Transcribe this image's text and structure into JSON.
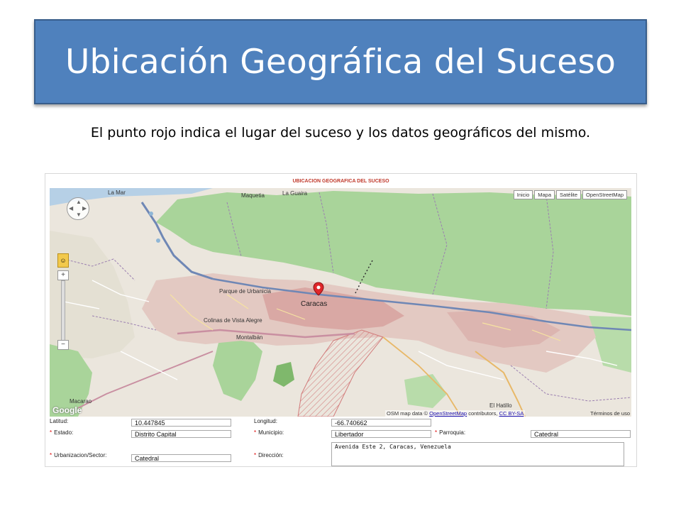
{
  "slide": {
    "title": "Ubicación Geográfica del Suceso",
    "subtitle": "El punto rojo indica el lugar del suceso y los datos geográficos del mismo."
  },
  "screenshot": {
    "header": "UBICACION GEOGRAFICA DEL SUCESO",
    "map_buttons": [
      "Inicio",
      "Mapa",
      "Satélite",
      "OpenStreetMap"
    ],
    "map_labels": {
      "la_mar": "La Mar",
      "maquetia": "Maquetia",
      "la_guaira": "La Guaira",
      "caracas": "Caracas",
      "el_hatillo": "El Hatillo",
      "macarao": "Macarao",
      "urbanismo": "Parque de Urbanicia",
      "vista_alegre": "Colinas de Vista Alegre",
      "montalban": "Montalbán"
    },
    "google_logo": "Google",
    "attribution": {
      "prefix": "OSM map data ©",
      "link1": "OpenStreetMap",
      "middle": "contributors,",
      "link2": "CC BY-SA",
      "terms": "Términos de uso"
    },
    "icons": {
      "pan": "pan-control-icon",
      "pegman": "pegman-icon",
      "marker": "red-location-marker-icon"
    },
    "colors": {
      "park_green": "#9fcf8e",
      "urban": "#d9a8a4",
      "marker_red": "#e0262a",
      "title_blue": "#4f81bd"
    },
    "form": {
      "latitud": {
        "label": "Latitud:",
        "value": "10.447845"
      },
      "longitud": {
        "label": "Longitud:",
        "value": "-66.740662"
      },
      "estado": {
        "label": "Estado:",
        "value": "Distrito Capital"
      },
      "municipio": {
        "label": "Municipio:",
        "value": "Libertador"
      },
      "parroquia": {
        "label": "Parroquia:",
        "value": "Catedral"
      },
      "urbanizacion": {
        "label": "Urbanizacion/Sector:",
        "value": "Catedral"
      },
      "direccion": {
        "label": "Dirección:",
        "value": "Avenida Este 2, Caracas, Venezuela"
      }
    }
  }
}
